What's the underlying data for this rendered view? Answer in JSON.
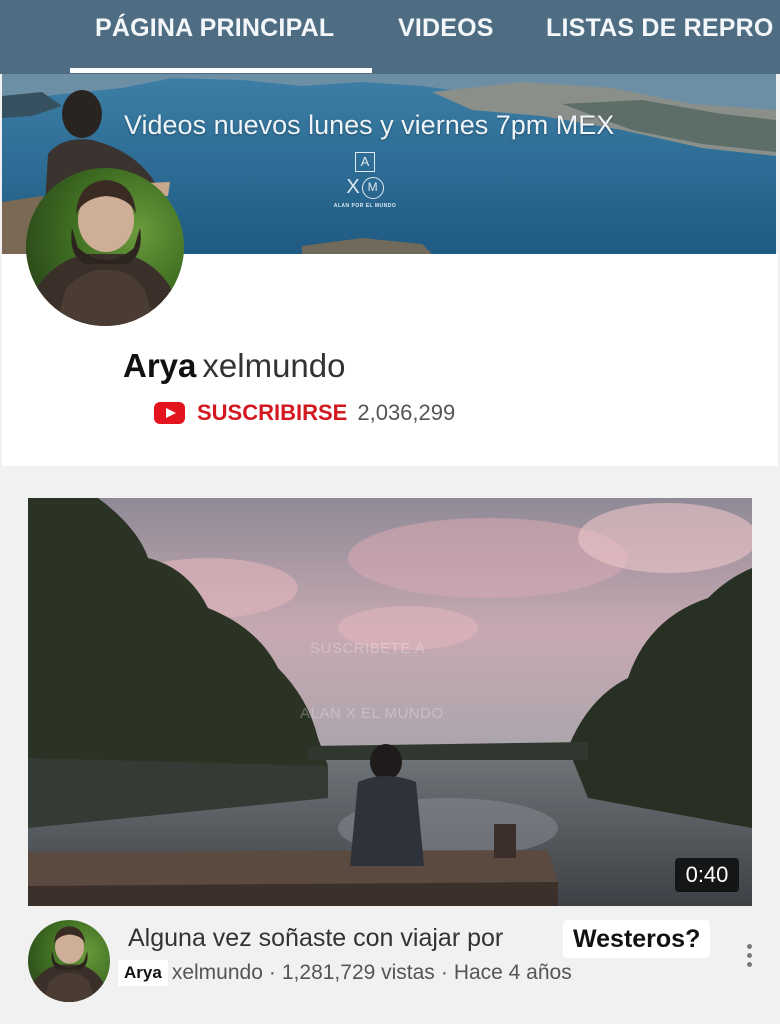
{
  "tabs": [
    {
      "label": "PÁGINA PRINCIPAL",
      "active": true
    },
    {
      "label": "VIDEOS",
      "active": false
    },
    {
      "label": "LISTAS DE REPRO",
      "active": false
    }
  ],
  "banner": {
    "caption": "Videos nuevos lunes y viernes 7pm MEX",
    "logo": {
      "top": "A",
      "middle_x": "X",
      "middle_m": "M",
      "sub": "ALAN POR EL MUNDO"
    }
  },
  "channel": {
    "name_bold": "Arya",
    "name_rest": "xelmundo",
    "subscribe_label": "SUSCRIBIRSE",
    "subscriber_count": "2,036,299",
    "subscribe_icon": "youtube-play-icon"
  },
  "video": {
    "duration": "0:40",
    "watermark_1": "SUSCRIBETE A",
    "watermark_2": "ALAN X EL MUNDO",
    "title_plain": "Alguna vez soñaste con viajar por",
    "title_highlight": "Westeros?",
    "channel_bold": "Arya",
    "channel_rest": "xelmundo",
    "views": "1,281,729 vistas",
    "age": "Hace 4 años",
    "separator": "·"
  },
  "colors": {
    "tabbar": "#4e6d82",
    "subscribe_red": "#d3191f",
    "youtube_red": "#e4141e"
  },
  "icons": {
    "more": "kebab-menu-icon"
  }
}
